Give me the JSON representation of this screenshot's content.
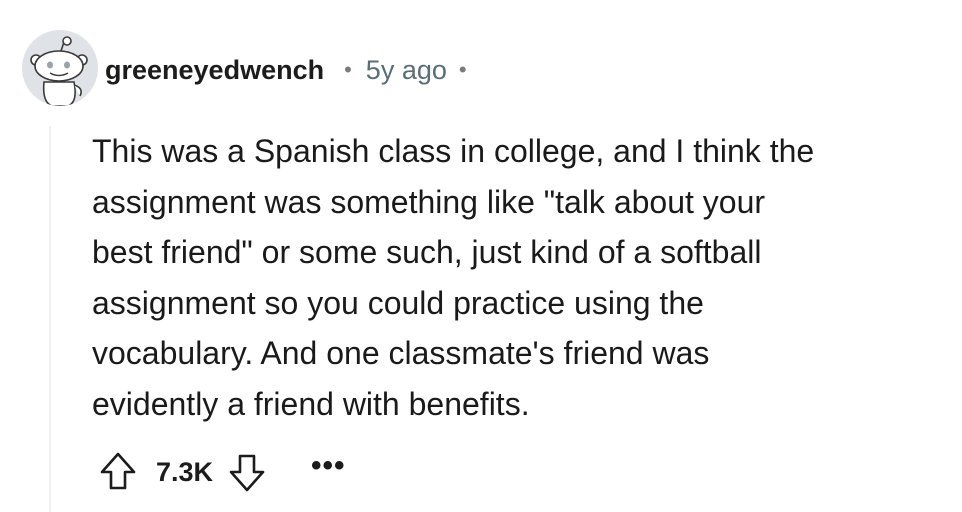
{
  "comment": {
    "username": "greeneyedwench",
    "separator": "•",
    "age": "5y ago",
    "trailing_separator": "•",
    "body": [
      "This was a Spanish class in college, and I think the",
      "assignment was something like \"talk about your",
      "best friend\" or some such, just kind of a softball",
      "assignment so you could practice using the",
      "vocabulary. And one classmate's friend was",
      "evidently a friend with benefits."
    ],
    "score": "7.3K",
    "more_label": "•••",
    "icons": {
      "avatar": "reddit-snoo-avatar-icon",
      "upvote": "upvote-arrow-icon",
      "downvote": "downvote-arrow-icon",
      "more": "more-options-icon"
    }
  },
  "colors": {
    "text": "#1a1a1b",
    "meta": "#576f76",
    "thread_line": "#edeff1",
    "avatar_bg": "#e4e6ea"
  }
}
